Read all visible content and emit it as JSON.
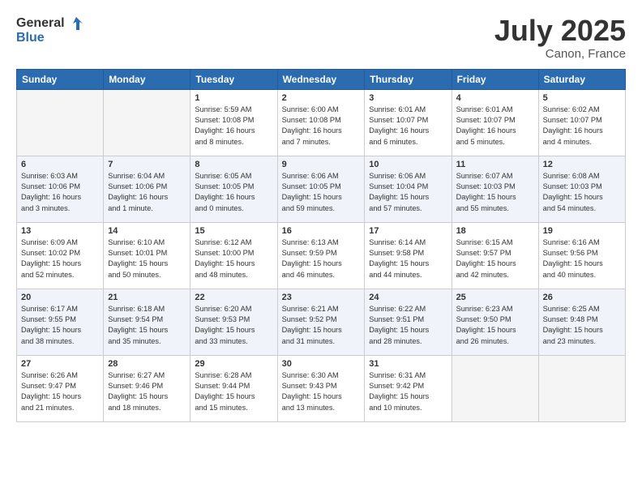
{
  "header": {
    "logo_general": "General",
    "logo_blue": "Blue",
    "month": "July 2025",
    "location": "Canon, France"
  },
  "days_of_week": [
    "Sunday",
    "Monday",
    "Tuesday",
    "Wednesday",
    "Thursday",
    "Friday",
    "Saturday"
  ],
  "weeks": [
    {
      "days": [
        {
          "num": "",
          "info": ""
        },
        {
          "num": "",
          "info": ""
        },
        {
          "num": "1",
          "info": "Sunrise: 5:59 AM\nSunset: 10:08 PM\nDaylight: 16 hours\nand 8 minutes."
        },
        {
          "num": "2",
          "info": "Sunrise: 6:00 AM\nSunset: 10:08 PM\nDaylight: 16 hours\nand 7 minutes."
        },
        {
          "num": "3",
          "info": "Sunrise: 6:01 AM\nSunset: 10:07 PM\nDaylight: 16 hours\nand 6 minutes."
        },
        {
          "num": "4",
          "info": "Sunrise: 6:01 AM\nSunset: 10:07 PM\nDaylight: 16 hours\nand 5 minutes."
        },
        {
          "num": "5",
          "info": "Sunrise: 6:02 AM\nSunset: 10:07 PM\nDaylight: 16 hours\nand 4 minutes."
        }
      ]
    },
    {
      "days": [
        {
          "num": "6",
          "info": "Sunrise: 6:03 AM\nSunset: 10:06 PM\nDaylight: 16 hours\nand 3 minutes."
        },
        {
          "num": "7",
          "info": "Sunrise: 6:04 AM\nSunset: 10:06 PM\nDaylight: 16 hours\nand 1 minute."
        },
        {
          "num": "8",
          "info": "Sunrise: 6:05 AM\nSunset: 10:05 PM\nDaylight: 16 hours\nand 0 minutes."
        },
        {
          "num": "9",
          "info": "Sunrise: 6:06 AM\nSunset: 10:05 PM\nDaylight: 15 hours\nand 59 minutes."
        },
        {
          "num": "10",
          "info": "Sunrise: 6:06 AM\nSunset: 10:04 PM\nDaylight: 15 hours\nand 57 minutes."
        },
        {
          "num": "11",
          "info": "Sunrise: 6:07 AM\nSunset: 10:03 PM\nDaylight: 15 hours\nand 55 minutes."
        },
        {
          "num": "12",
          "info": "Sunrise: 6:08 AM\nSunset: 10:03 PM\nDaylight: 15 hours\nand 54 minutes."
        }
      ]
    },
    {
      "days": [
        {
          "num": "13",
          "info": "Sunrise: 6:09 AM\nSunset: 10:02 PM\nDaylight: 15 hours\nand 52 minutes."
        },
        {
          "num": "14",
          "info": "Sunrise: 6:10 AM\nSunset: 10:01 PM\nDaylight: 15 hours\nand 50 minutes."
        },
        {
          "num": "15",
          "info": "Sunrise: 6:12 AM\nSunset: 10:00 PM\nDaylight: 15 hours\nand 48 minutes."
        },
        {
          "num": "16",
          "info": "Sunrise: 6:13 AM\nSunset: 9:59 PM\nDaylight: 15 hours\nand 46 minutes."
        },
        {
          "num": "17",
          "info": "Sunrise: 6:14 AM\nSunset: 9:58 PM\nDaylight: 15 hours\nand 44 minutes."
        },
        {
          "num": "18",
          "info": "Sunrise: 6:15 AM\nSunset: 9:57 PM\nDaylight: 15 hours\nand 42 minutes."
        },
        {
          "num": "19",
          "info": "Sunrise: 6:16 AM\nSunset: 9:56 PM\nDaylight: 15 hours\nand 40 minutes."
        }
      ]
    },
    {
      "days": [
        {
          "num": "20",
          "info": "Sunrise: 6:17 AM\nSunset: 9:55 PM\nDaylight: 15 hours\nand 38 minutes."
        },
        {
          "num": "21",
          "info": "Sunrise: 6:18 AM\nSunset: 9:54 PM\nDaylight: 15 hours\nand 35 minutes."
        },
        {
          "num": "22",
          "info": "Sunrise: 6:20 AM\nSunset: 9:53 PM\nDaylight: 15 hours\nand 33 minutes."
        },
        {
          "num": "23",
          "info": "Sunrise: 6:21 AM\nSunset: 9:52 PM\nDaylight: 15 hours\nand 31 minutes."
        },
        {
          "num": "24",
          "info": "Sunrise: 6:22 AM\nSunset: 9:51 PM\nDaylight: 15 hours\nand 28 minutes."
        },
        {
          "num": "25",
          "info": "Sunrise: 6:23 AM\nSunset: 9:50 PM\nDaylight: 15 hours\nand 26 minutes."
        },
        {
          "num": "26",
          "info": "Sunrise: 6:25 AM\nSunset: 9:48 PM\nDaylight: 15 hours\nand 23 minutes."
        }
      ]
    },
    {
      "days": [
        {
          "num": "27",
          "info": "Sunrise: 6:26 AM\nSunset: 9:47 PM\nDaylight: 15 hours\nand 21 minutes."
        },
        {
          "num": "28",
          "info": "Sunrise: 6:27 AM\nSunset: 9:46 PM\nDaylight: 15 hours\nand 18 minutes."
        },
        {
          "num": "29",
          "info": "Sunrise: 6:28 AM\nSunset: 9:44 PM\nDaylight: 15 hours\nand 15 minutes."
        },
        {
          "num": "30",
          "info": "Sunrise: 6:30 AM\nSunset: 9:43 PM\nDaylight: 15 hours\nand 13 minutes."
        },
        {
          "num": "31",
          "info": "Sunrise: 6:31 AM\nSunset: 9:42 PM\nDaylight: 15 hours\nand 10 minutes."
        },
        {
          "num": "",
          "info": ""
        },
        {
          "num": "",
          "info": ""
        }
      ]
    }
  ]
}
